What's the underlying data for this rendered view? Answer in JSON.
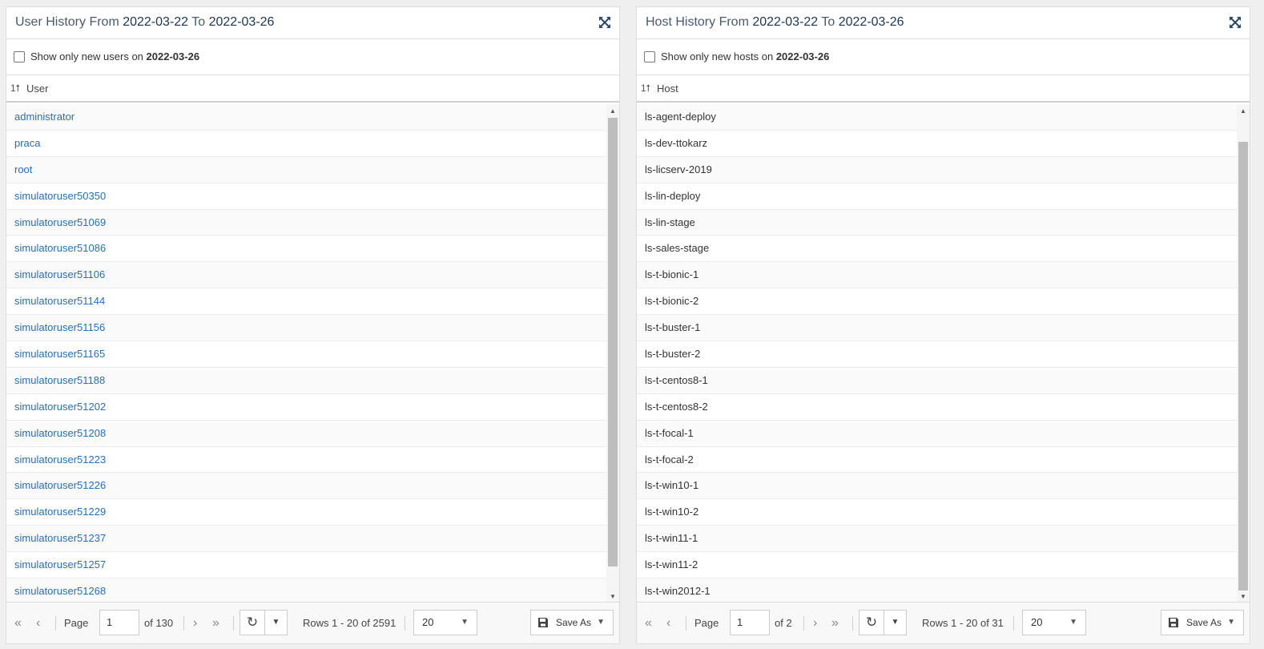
{
  "user_panel": {
    "title_prefix": "User History From",
    "date_from": "2022-03-22",
    "title_mid": "To",
    "date_to": "2022-03-26",
    "filter_text": "Show only new users on",
    "filter_date": "2022-03-26",
    "filter_checked": false,
    "sort_indicator": "1⭡",
    "column_header": "User",
    "rows": [
      "administrator",
      "praca",
      "root",
      "simulatoruser50350",
      "simulatoruser51069",
      "simulatoruser51086",
      "simulatoruser51106",
      "simulatoruser51144",
      "simulatoruser51156",
      "simulatoruser51165",
      "simulatoruser51188",
      "simulatoruser51202",
      "simulatoruser51208",
      "simulatoruser51223",
      "simulatoruser51226",
      "simulatoruser51229",
      "simulatoruser51237",
      "simulatoruser51257",
      "simulatoruser51268"
    ],
    "pager": {
      "page_label": "Page",
      "page_value": "1",
      "of_pages": "of 130",
      "rows_info": "Rows 1 - 20 of 2591",
      "page_size": "20",
      "save_as": "Save As"
    }
  },
  "host_panel": {
    "title_prefix": "Host History From",
    "date_from": "2022-03-22",
    "title_mid": "To",
    "date_to": "2022-03-26",
    "filter_text": "Show only new hosts on",
    "filter_date": "2022-03-26",
    "filter_checked": false,
    "sort_indicator": "1⭡",
    "column_header": "Host",
    "rows": [
      "ls-agent-deploy",
      "ls-dev-ttokarz",
      "ls-licserv-2019",
      "ls-lin-deploy",
      "ls-lin-stage",
      "ls-sales-stage",
      "ls-t-bionic-1",
      "ls-t-bionic-2",
      "ls-t-buster-1",
      "ls-t-buster-2",
      "ls-t-centos8-1",
      "ls-t-centos8-2",
      "ls-t-focal-1",
      "ls-t-focal-2",
      "ls-t-win10-1",
      "ls-t-win10-2",
      "ls-t-win11-1",
      "ls-t-win11-2",
      "ls-t-win2012-1"
    ],
    "pager": {
      "page_label": "Page",
      "page_value": "1",
      "of_pages": "of 2",
      "rows_info": "Rows 1 - 20 of 31",
      "page_size": "20",
      "save_as": "Save As"
    }
  },
  "icons": {
    "first": "«",
    "prev": "‹",
    "next": "›",
    "last": "»",
    "refresh": "↻",
    "caret": "▼",
    "scroll_up": "▲",
    "scroll_down": "▼"
  },
  "colors": {
    "link": "#2a6db0",
    "title_date": "#1e3550",
    "scroll_thumb": "#bdbdbd"
  }
}
